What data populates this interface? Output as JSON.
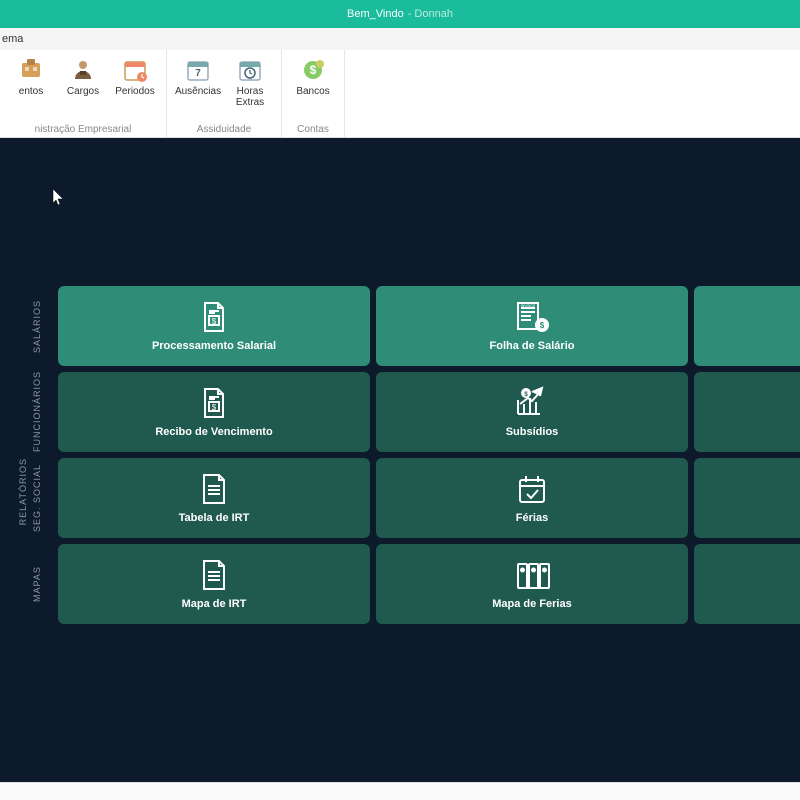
{
  "titlebar": {
    "page": "Bem_Vindo",
    "app": "Donnah"
  },
  "menubar": {
    "item": "ema"
  },
  "ribbon": {
    "groups": [
      {
        "label": "nistração Empresarial",
        "items": [
          {
            "label": "entos",
            "icon": "department-icon"
          },
          {
            "label": "Cargos",
            "icon": "cargo-icon"
          },
          {
            "label": "Periodos",
            "icon": "period-icon"
          }
        ]
      },
      {
        "label": "Assiduidade",
        "items": [
          {
            "label": "Ausências",
            "icon": "calendar-icon"
          },
          {
            "label": "Horas Extras",
            "icon": "clock-icon"
          }
        ]
      },
      {
        "label": "Contas",
        "items": [
          {
            "label": "Bancos",
            "icon": "bank-icon"
          }
        ]
      }
    ]
  },
  "sideLabels": [
    "SALÁRIOS",
    "FUNCIONÁRIOS",
    "SEG. SOCIAL",
    "MAPAS"
  ],
  "sideLabelExtra": "RELATÓRIOS",
  "cards": [
    {
      "label": "Processamento Salarial",
      "icon": "money-doc-icon",
      "highlight": true
    },
    {
      "label": "Folha de Salário",
      "icon": "invoice-icon",
      "highlight": true
    },
    {
      "label": "",
      "icon": "",
      "highlight": true
    },
    {
      "label": "Recibo de Vencimento",
      "icon": "money-doc-icon",
      "highlight": false
    },
    {
      "label": "Subsídios",
      "icon": "growth-icon",
      "highlight": false
    },
    {
      "label": "",
      "icon": "",
      "highlight": false
    },
    {
      "label": "Tabela de IRT",
      "icon": "doc-icon",
      "highlight": false
    },
    {
      "label": "Férias",
      "icon": "vacation-icon",
      "highlight": false
    },
    {
      "label": "",
      "icon": "",
      "highlight": false
    },
    {
      "label": "Mapa de IRT",
      "icon": "doc-icon",
      "highlight": false
    },
    {
      "label": "Mapa de Ferias",
      "icon": "binder-icon",
      "highlight": false
    },
    {
      "label": "",
      "icon": "",
      "highlight": false
    }
  ]
}
